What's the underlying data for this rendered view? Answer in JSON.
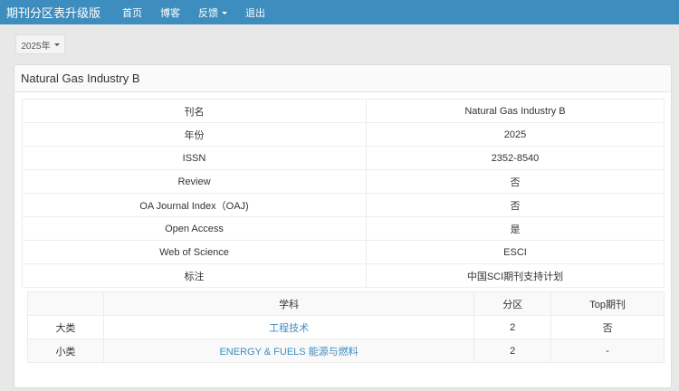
{
  "navbar": {
    "brand": "期刊分区表升级版",
    "items": [
      "首页",
      "博客",
      "反馈",
      "退出"
    ]
  },
  "year_selector": {
    "label": "2025年"
  },
  "panel": {
    "title": "Natural Gas Industry B",
    "info_rows": [
      {
        "label": "刊名",
        "value": "Natural Gas Industry B"
      },
      {
        "label": "年份",
        "value": "2025"
      },
      {
        "label": "ISSN",
        "value": "2352-8540"
      },
      {
        "label": "Review",
        "value": "否"
      },
      {
        "label": "OA Journal Index（OAJ)",
        "value": "否"
      },
      {
        "label": "Open Access",
        "value": "是"
      },
      {
        "label": "Web of Science",
        "value": "ESCI"
      },
      {
        "label": "标注",
        "value": "中国SCI期刊支持计划"
      }
    ],
    "subject_table": {
      "headers": [
        "",
        "学科",
        "分区",
        "Top期刊"
      ],
      "rows": [
        {
          "type": "大类",
          "subject": "工程技术",
          "zone": "2",
          "top": "否"
        },
        {
          "type": "小类",
          "subject": "ENERGY & FUELS 能源与燃料",
          "zone": "2",
          "top": "-"
        }
      ]
    }
  },
  "colors": {
    "navbar": "#3d8dbf",
    "link": "#3d8dbf"
  }
}
